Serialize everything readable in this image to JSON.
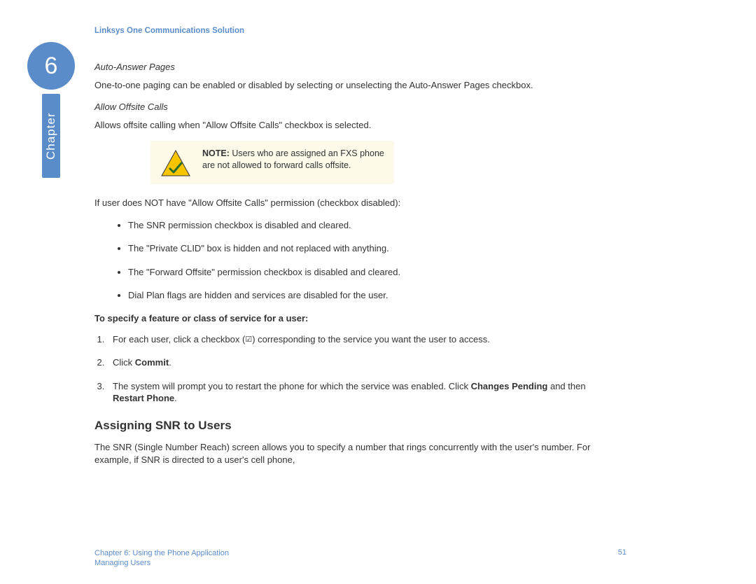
{
  "chapter": {
    "number": "6",
    "label": "Chapter"
  },
  "header": "Linksys One Communications Solution",
  "sections": {
    "autoAnswer": {
      "title": "Auto-Answer Pages",
      "body": "One-to-one paging can be enabled or disabled by selecting or unselecting the Auto-Answer Pages checkbox."
    },
    "allowOffsite": {
      "title": "Allow Offsite Calls",
      "body": "Allows offsite calling when \"Allow Offsite Calls\" checkbox is selected."
    },
    "note": {
      "label": "NOTE:",
      "text": " Users who are assigned an FXS phone are not allowed to forward calls offsite."
    },
    "noPermissionIntro": "If user does NOT have \"Allow Offsite Calls\" permission (checkbox disabled):",
    "bullets": [
      "The SNR permission checkbox is disabled and cleared.",
      "The \"Private CLID\" box is hidden and not replaced with anything.",
      "The \"Forward Offsite\" permission checkbox is disabled and cleared.",
      "Dial Plan flags are hidden and services are disabled for the user."
    ],
    "specifyTitle": "To specify a feature or class of service for a user:",
    "steps": {
      "s1a": "For each user, click a checkbox (",
      "s1b": ") corresponding to the service you want the user to access.",
      "s2a": "Click ",
      "s2b": "Commit",
      "s2c": ".",
      "s3a": "The system will prompt you to restart the phone for which the service was enabled. Click ",
      "s3b": "Changes Pending",
      "s3c": " and then ",
      "s3d": "Restart Phone",
      "s3e": "."
    },
    "snr": {
      "title": "Assigning SNR to Users",
      "body": "The SNR (Single Number Reach) screen allows you to specify a number that rings concurrently with the user's number. For example, if SNR is directed to a user's cell phone,"
    }
  },
  "footer": {
    "line1": "Chapter 6: Using the Phone Application",
    "line2": "Managing Users",
    "page": "51"
  }
}
